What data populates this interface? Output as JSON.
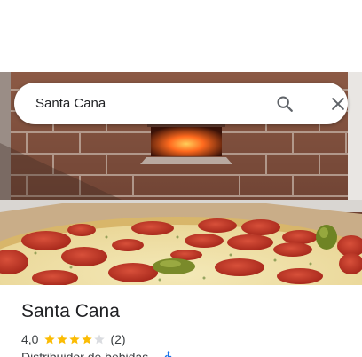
{
  "search": {
    "query": "Santa Cana"
  },
  "place": {
    "name": "Santa Cana",
    "rating": "4,0",
    "stars_filled": 4,
    "stars_total": 5,
    "reviews": "(2)",
    "category": "Distribuidor de bebidas",
    "separator": "·"
  },
  "icons": {
    "search": "search-icon",
    "close": "close-icon",
    "accessibility": "wheelchair-icon"
  },
  "colors": {
    "star_filled": "#fbbc04",
    "star_empty": "#dadce0",
    "accent": "#1a73e8"
  }
}
